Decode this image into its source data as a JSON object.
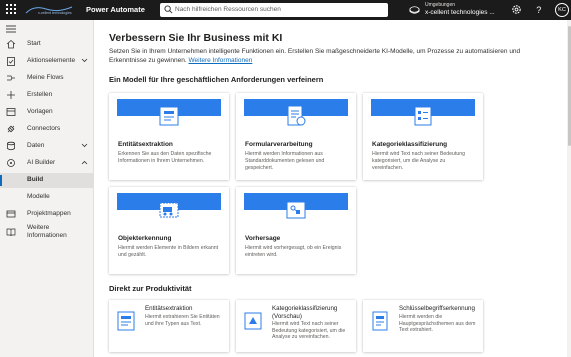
{
  "header": {
    "app_name": "Power Automate",
    "search_placeholder": "Nach hilfreichen Ressourcen suchen",
    "environment_label": "Umgebungen",
    "environment_value": "x-cellent technologies ...",
    "avatar_initials": "KC",
    "logo_text": "x-cellent technologies"
  },
  "sidebar": {
    "items": [
      {
        "label": "Start",
        "icon": "home-icon"
      },
      {
        "label": "Aktionselemente",
        "icon": "clipboard-check-icon"
      },
      {
        "label": "Meine Flows",
        "icon": "flows-icon"
      },
      {
        "label": "Erstellen",
        "icon": "plus-icon"
      },
      {
        "label": "Vorlagen",
        "icon": "templates-icon"
      },
      {
        "label": "Connectors",
        "icon": "connectors-icon"
      },
      {
        "label": "Daten",
        "icon": "database-icon"
      },
      {
        "label": "AI Builder",
        "icon": "ai-builder-icon"
      },
      {
        "label": "Build"
      },
      {
        "label": "Modelle"
      },
      {
        "label": "Projektmappen",
        "icon": "solutions-icon"
      },
      {
        "label": "Weitere Informationen",
        "icon": "book-icon"
      }
    ]
  },
  "main": {
    "title": "Verbessern Sie Ihr Business mit KI",
    "description": "Setzen Sie in Ihrem Unternehmen intelligente Funktionen ein. Erstellen Sie maßgeschneiderte KI-Modelle, um Prozesse zu automatisieren und Erkenntnisse zu gewinnen.",
    "learn_more": "Weitere Informationen",
    "section1_title": "Ein Modell für Ihre geschäftlichen Anforderungen verfeinern",
    "section2_title": "Direkt zur Produktivität",
    "model_cards": [
      {
        "title": "Entitätsextraktion",
        "description": "Erkennen Sie aus den Daten spezifische Informationen in Ihrem Unternehmen."
      },
      {
        "title": "Formularverarbeitung",
        "description": "Hiermit werden Informationen aus Standarddokumenten gelesen und gespeichert."
      },
      {
        "title": "Kategorieklassifizierung",
        "description": "Hiermit wird Text nach seiner Bedeutung kategorisiert, um die Analyse zu vereinfachen."
      },
      {
        "title": "Objekterkennung",
        "description": "Hiermit werden Elemente in Bildern erkannt und gezählt."
      },
      {
        "title": "Vorhersage",
        "description": "Hiermit wird vorhergesagt, ob ein Ereignis eintreten wird."
      }
    ],
    "prebuilt_cards": [
      {
        "title": "Entitätsextraktion",
        "description": "Hiermit extrahieren Sie Entitäten und ihre Typen aus Text."
      },
      {
        "title": "Kategorieklassifizierung (Vorschau)",
        "description": "Hiermit wird Text nach seiner Bedeutung kategorisiert, um die Analyse zu vereinfachen."
      },
      {
        "title": "Schlüsselbegriffserkennung",
        "description": "Hiermit werden die Hauptgesprächsthemen aus dem Text extrahiert."
      }
    ]
  },
  "colors": {
    "accent": "#0f6cbd",
    "card_band": "#2b7de9",
    "topbar": "#1b1b1b",
    "sidebar": "#f3f2f1"
  }
}
